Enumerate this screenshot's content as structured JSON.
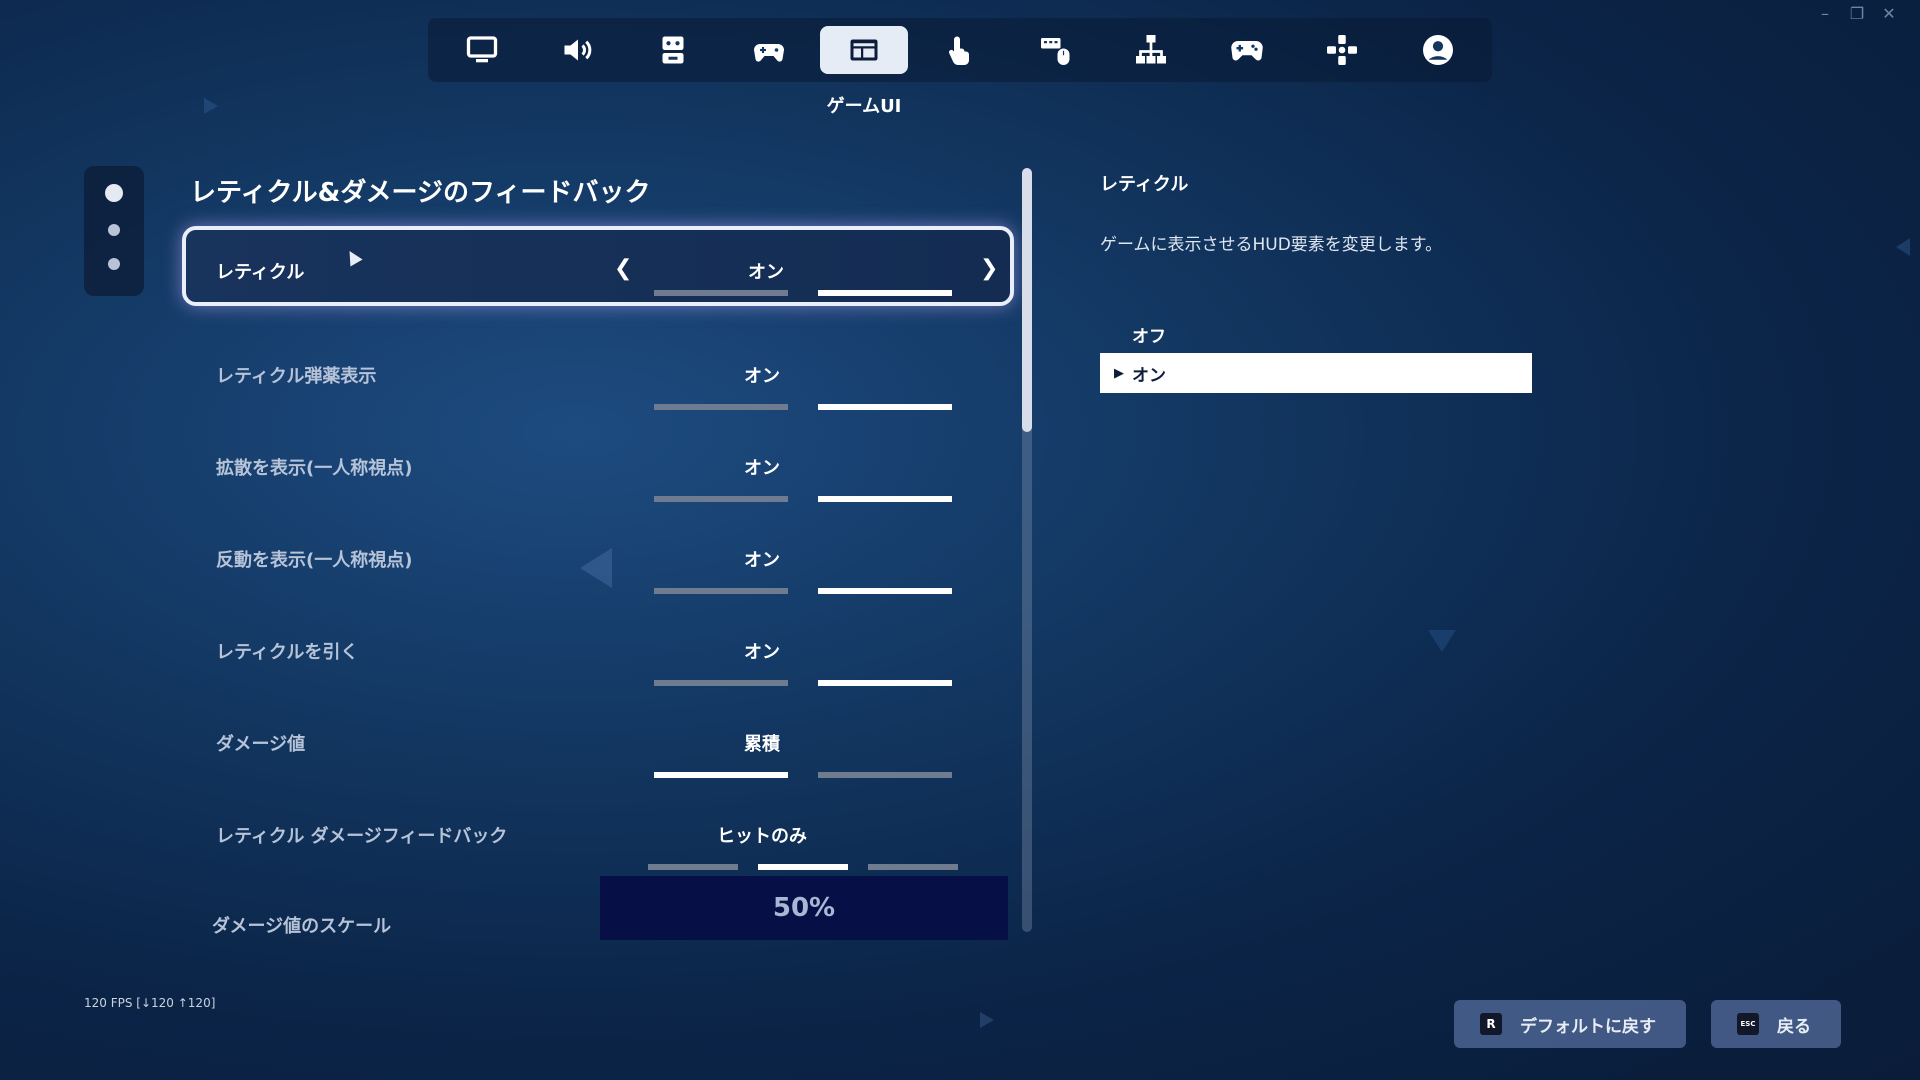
{
  "window": {
    "minimize": "–",
    "maximize": "❐",
    "close": "✕"
  },
  "tabs": [
    {
      "id": "display",
      "icon": "monitor-icon",
      "active": false
    },
    {
      "id": "audio",
      "icon": "speaker-icon",
      "active": false
    },
    {
      "id": "accessibility",
      "icon": "accessibility-icon",
      "active": false
    },
    {
      "id": "input",
      "icon": "controller-settings-icon",
      "active": false
    },
    {
      "id": "game-ui",
      "icon": "game-ui-icon",
      "active": true
    },
    {
      "id": "touch",
      "icon": "touch-icon",
      "active": false
    },
    {
      "id": "keyboard-mouse",
      "icon": "keyboard-mouse-icon",
      "active": false
    },
    {
      "id": "hierarchy",
      "icon": "hierarchy-icon",
      "active": false
    },
    {
      "id": "controller",
      "icon": "gamepad-icon",
      "active": false
    },
    {
      "id": "controller-binds",
      "icon": "dpad-icon",
      "active": false
    },
    {
      "id": "account",
      "icon": "account-icon",
      "active": false
    }
  ],
  "tab_title": "ゲームUI",
  "section_title": "レティクル&ダメージのフィードバック",
  "settings": [
    {
      "label": "レティクル",
      "value": "オン",
      "segments": [
        false,
        true
      ]
    },
    {
      "label": "レティクル弾薬表示",
      "value": "オン",
      "segments": [
        false,
        true
      ]
    },
    {
      "label": "拡散を表示(一人称視点)",
      "value": "オン",
      "segments": [
        false,
        true
      ]
    },
    {
      "label": "反動を表示(一人称視点)",
      "value": "オン",
      "segments": [
        false,
        true
      ]
    },
    {
      "label": "レティクルを引く",
      "value": "オン",
      "segments": [
        false,
        true
      ]
    },
    {
      "label": "ダメージ値",
      "value": "累積",
      "segments": [
        true,
        false
      ]
    },
    {
      "label": "レティクル ダメージフィードバック",
      "value": "ヒットのみ",
      "segments": [
        false,
        true,
        false
      ]
    },
    {
      "label": "ダメージ値のスケール",
      "value": "50%"
    }
  ],
  "description": {
    "title": "レティクル",
    "text": "ゲームに表示させるHUD要素を変更します。",
    "options": [
      "オフ",
      "オン"
    ],
    "selected_option": "オン"
  },
  "fps": "120 FPS [↓120 ↑120]",
  "footer": {
    "reset_key": "R",
    "reset_label": "デフォルトに戻す",
    "back_key": "ESC",
    "back_label": "戻る"
  },
  "colors": {
    "accent_tab": "#e6ecf6",
    "focus_border": "#e9eefb",
    "scale_box": "#061046"
  }
}
